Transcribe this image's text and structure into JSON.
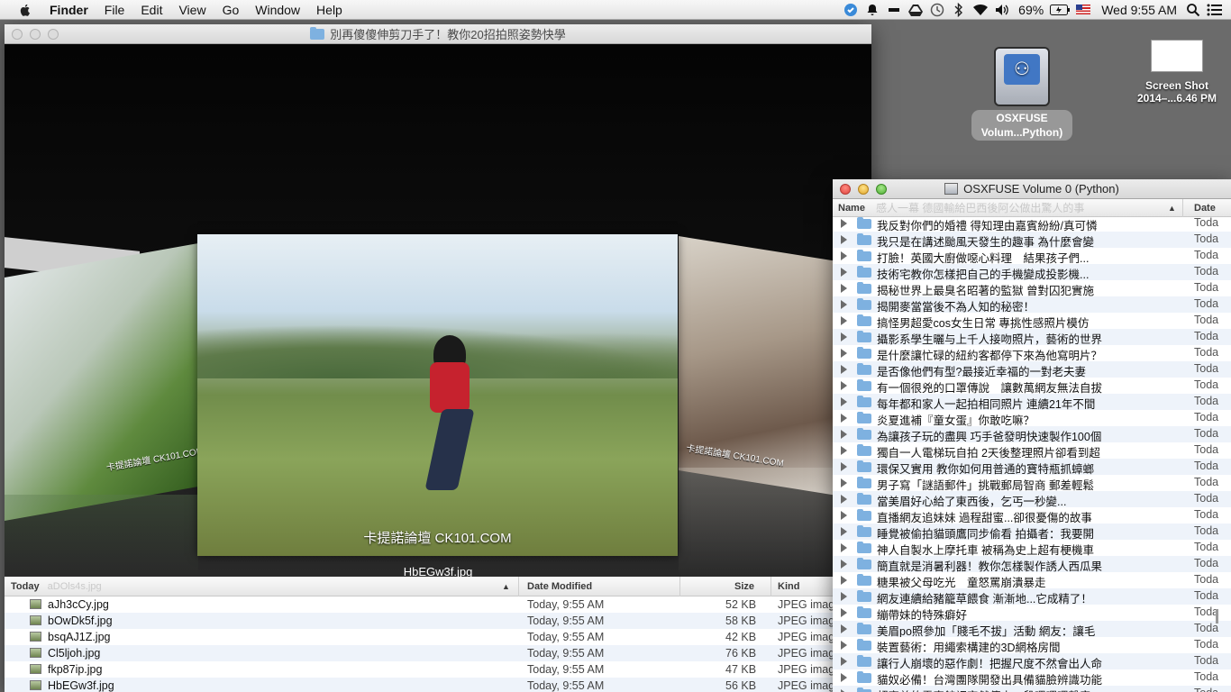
{
  "menubar": {
    "app_name": "Finder",
    "items": [
      "File",
      "Edit",
      "View",
      "Go",
      "Window",
      "Help"
    ],
    "battery": "69%",
    "datetime": "Wed 9:55 AM",
    "status_icons": [
      "evernote-icon",
      "bell-icon",
      "minus-icon",
      "google-drive-icon",
      "time-machine-icon",
      "bluetooth-icon",
      "wifi-icon",
      "volume-icon",
      "battery-icon",
      "us-flag-icon",
      "spotlight-icon",
      "notification-center-icon"
    ]
  },
  "desktop": {
    "drive_label_line1": "OSXFUSE",
    "drive_label_line2": "Volum...Python)",
    "screenshot_label_line1": "Screen Shot",
    "screenshot_label_line2": "2014–...6.46 PM"
  },
  "main_window": {
    "title": "別再傻傻伸剪刀手了！教你20招拍照姿勢快學",
    "cover_caption": "HbEGw3f.jpg",
    "watermark": "卡提諾論壇 CK101.COM",
    "side_watermark": "卡提諾論壇 CK101.COM",
    "list_header": {
      "name": "Today",
      "ghost_name": "aDOls4s.jpg",
      "date": "Date Modified",
      "size": "Size",
      "kind": "Kind"
    },
    "files": [
      {
        "name": "aJh3cCy.jpg",
        "date": "Today, 9:55 AM",
        "size": "52 KB",
        "kind": "JPEG image"
      },
      {
        "name": "bOwDk5f.jpg",
        "date": "Today, 9:55 AM",
        "size": "58 KB",
        "kind": "JPEG image"
      },
      {
        "name": "bsqAJ1Z.jpg",
        "date": "Today, 9:55 AM",
        "size": "42 KB",
        "kind": "JPEG image"
      },
      {
        "name": "Cl5ljoh.jpg",
        "date": "Today, 9:55 AM",
        "size": "76 KB",
        "kind": "JPEG image"
      },
      {
        "name": "fkp87ip.jpg",
        "date": "Today, 9:55 AM",
        "size": "47 KB",
        "kind": "JPEG image"
      },
      {
        "name": "HbEGw3f.jpg",
        "date": "Today, 9:55 AM",
        "size": "56 KB",
        "kind": "JPEG image"
      }
    ]
  },
  "python_window": {
    "title": "OSXFUSE Volume 0 (Python)",
    "header_name": "Name",
    "header_date": "Date",
    "ghost_row": "感人一幕 德國輸給巴西後阿公做出驚人的事",
    "date_value": "Toda",
    "folders": [
      "我反對你們的婚禮 得知理由嘉賓紛紛/真可憐",
      "我只是在講述颱風天發生的趣事 為什麼會變",
      "打臉！英國大廚做噁心料理　結果孩子們...",
      "技術宅教你怎樣把自己的手機變成投影機...",
      "揭秘世界上最臭名昭著的監獄 曾對囚犯實施",
      "揭開麥當當後不為人知的秘密！",
      "搞怪男超愛cos女生日常 專挑性感照片模仿",
      "攝影系學生曬与上千人接吻照片，藝術的世界",
      "是什麼讓忙碌的紐約客都停下來為他寫明片？",
      "是否像他們有型?最接近幸福的一對老夫妻",
      "有一個很兇的口罩傳說　讓數萬網友無法自拔",
      "每年都和家人一起拍相同照片 連續21年不間",
      "炎夏進補『童女蛋』你敢吃嘛？",
      "為讓孩子玩的盡興 巧手爸發明快速製作100個",
      "獨自一人電梯玩自拍 2天後整理照片卻看到超",
      "環保又實用 教你如何用普通的寶特瓶抓蟑螂",
      "男子寫「謎語郵件」挑戰郵局智商 郵差輕鬆",
      "當美眉好心給了東西後，乞丐一秒變...",
      "直播網友追妹妹 過程甜蜜...卻很憂傷的故事",
      "睡覺被偷拍貓頭鷹同步偷看 拍攝者：我要開",
      "神人自製水上摩托車 被稱為史上超有梗機車",
      "簡直就是消暑利器！教你怎樣製作誘人西瓜果",
      "糖果被父母吃光　童怒罵崩潰暴走",
      "網友連續給豬籠草餵食 漸漸地...它成精了！",
      "繃帶妹的特殊癖好",
      "美眉po照參加「賤毛不拔」活動 網友：讓毛",
      "裝置藝術：用繩索構建的3D網格房間",
      "讓行人崩壞的惡作劇！把握尺度不然會出人命",
      "貓奴必備！台灣團隊開發出具備貓臉辨識功能",
      "超害羞的電車館裡突然傳來一段嗶嗶嗶聲音"
    ]
  }
}
